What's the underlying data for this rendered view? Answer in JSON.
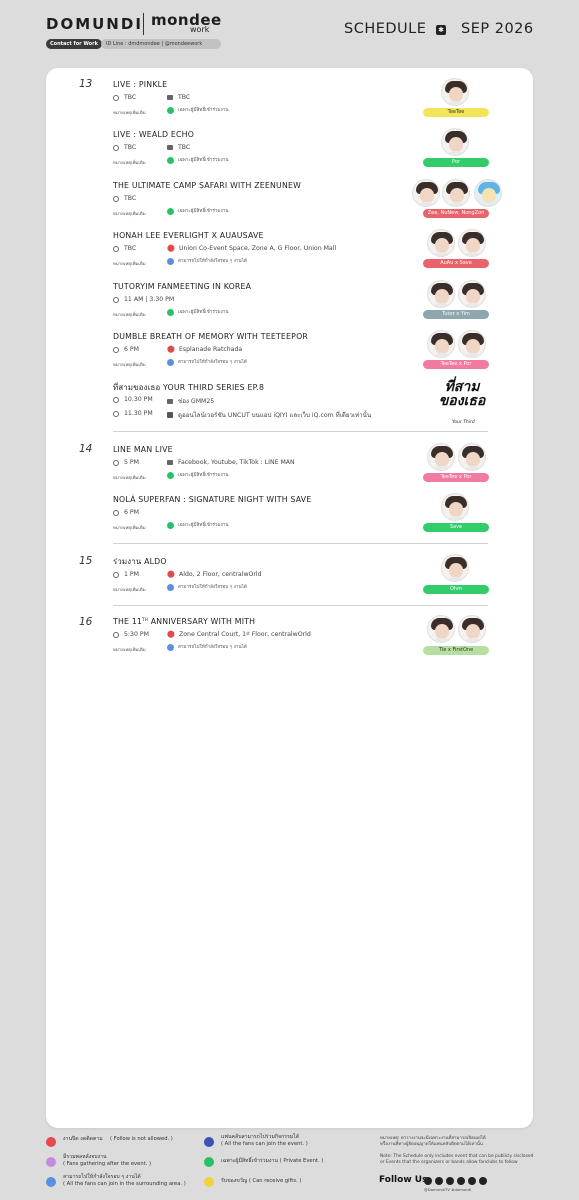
{
  "header": {
    "brand": "DOMUNDI",
    "partner": "mondee",
    "partner_sub": "work",
    "contact_label": "Contact for Work",
    "id_line": "ID Line : dmdmondee | @mondeework",
    "title": "SCHEDULE",
    "date": "SEP 2026"
  },
  "days": [
    {
      "day": "13",
      "events": [
        {
          "title": "LIVE : PINKLE",
          "time": "TBC",
          "place": "TBC",
          "note_label": "หมายเหตุเพิ่มเติม",
          "note": "เฉพาะผู้มีสิทธิ์เข้าร่วมงาน",
          "badge": "TeeTee"
        },
        {
          "title": "LIVE : WEALD ECHO",
          "time": "TBC",
          "place": "TBC",
          "note_label": "หมายเหตุเพิ่มเติม",
          "note": "เฉพาะผู้มีสิทธิ์เข้าร่วมงาน",
          "badge": "Por"
        },
        {
          "title": "THE ULTIMATE CAMP SAFARI WITH ZEENUNEW",
          "time": "TBC",
          "note_label": "หมายเหตุเพิ่มเติม",
          "note": "เฉพาะผู้มีสิทธิ์เข้าร่วมงาน",
          "badge": "Zee, NuNew, NongZon"
        },
        {
          "title": "HONAH LEE EVERLIGHT X AUAUSAVE",
          "time": "TBC",
          "place": "Union Co-Event Space, Zone A, G Floor, Union Mall",
          "note_label": "หมายเหตุเพิ่มเติม",
          "note": "สามารถไปให้กำลังใจรอบ ๆ งานได้",
          "badge": "AuAu  x  Save"
        },
        {
          "title": "TUTORYIM FANMEETING IN KOREA",
          "time": "11 AM  |  3.30 PM",
          "note_label": "หมายเหตุเพิ่มเติม",
          "note": "เฉพาะผู้มีสิทธิ์เข้าร่วมงาน",
          "badge": "Tutor  x  Yim"
        },
        {
          "title": "DUMBLE BREATH OF MEMORY WITH TEETEEPOR",
          "time": "6 PM",
          "place": "Esplanade Ratchada",
          "note_label": "หมายเหตุเพิ่มเติม",
          "note": "สามารถไปให้กำลังใจรอบ ๆ งานได้",
          "badge": "TeeTee  x  Por"
        },
        {
          "title": "ที่สามของเธอ YOUR THIRD SERIES EP.8",
          "time": "10.30 PM",
          "place": "ช่อง GMM25",
          "time2": "11.30 PM",
          "place2": "ดูออนไลน์เวอร์ชัน UNCUT บนแอป iQIYI และเว็บ iQ.com ที่เดียวเท่านั้น",
          "logo": "ที่สาม ของเธอ",
          "logo_sub": "Your Third"
        }
      ]
    },
    {
      "day": "14",
      "events": [
        {
          "title": "LINE MAN LIVE",
          "time": "5 PM",
          "place": "Facebook, Youtube, TikTok : LINE MAN",
          "note_label": "หมายเหตุเพิ่มเติม",
          "note": "เฉพาะผู้มีสิทธิ์เข้าร่วมงาน",
          "badge": "TeeTee  x  Por"
        },
        {
          "title": "NOLÁ SUPERFAN : SIGNATURE NIGHT WITH SAVE",
          "time": "6 PM",
          "note_label": "หมายเหตุเพิ่มเติม",
          "note": "เฉพาะผู้มีสิทธิ์เข้าร่วมงาน",
          "badge": "Save"
        }
      ]
    },
    {
      "day": "15",
      "events": [
        {
          "title": "ร่วมงาน ALDO",
          "time": "1 PM",
          "place": "Aldo, 2 Floor, centralwOrld",
          "note_label": "หมายเหตุเพิ่มเติม",
          "note": "สามารถไปให้กำลังใจรอบ ๆ งานได้",
          "badge": "Ohm"
        }
      ]
    },
    {
      "day": "16",
      "events": [
        {
          "title_pre": "THE 11",
          "title_sup": "TH",
          "title_post": " ANNIVERSARY WITH MITH",
          "time": "5:30 PM",
          "place_pre": "Zone Central Court, 1",
          "place_sup": "st",
          "place_post": " Floor, centralwOrld",
          "note_label": "หมายเหตุเพิ่มเติม",
          "note": "สามารถไปให้กำลังใจรอบ ๆ งานได้",
          "badge": "Tle  x  FirstOne"
        }
      ]
    }
  ],
  "legend": {
    "items": [
      {
        "th": "งานปิด งดติดตาม",
        "en": "( Follow is not allowed. )",
        "icon": "no-entry-icon",
        "color": "#e5484d"
      },
      {
        "th": "มีรวมพลหลังจบงาน",
        "en": "( Fans gathering after the event. )",
        "icon": "gathering-icon",
        "color": "#c58be0"
      },
      {
        "th": "สามารถไปให้กำลังใจรอบ ๆ งานได้",
        "en": "( All the fans can join in the surrounding area. )",
        "icon": "thumbs-up-icon",
        "color": "#5b8fe0"
      },
      {
        "th": "แฟนคลับสามารถไปร่วมกิจกรรมได้",
        "en": "( All the fans can join the event. )",
        "icon": "group-icon",
        "color": "#3f51b5"
      },
      {
        "th": "เฉพาะผู้มีสิทธิ์เข้าร่วมงาน",
        "en": "( Private Event. )",
        "icon": "private-icon",
        "color": "#27c268"
      },
      {
        "th": "รับของขวัญ",
        "en": "( Can receive gifts. )",
        "icon": "gift-icon",
        "color": "#f1d23a"
      }
    ],
    "note_th_1": "หมายเหตุ: ตารางงานจะมีเฉพาะงานที่สามารถเปิดเผยได้",
    "note_th_2": "หรืองานที่ทางผู้จัดอนุญาตให้แฟนคลับติดตามได้เท่านั้น",
    "note_en_1": "Note: The Schedule only includes event that can be publicly sisclosed",
    "note_en_2": "or Events that the organizers or bands allow fanclubs to follow",
    "follow": "Follow Us",
    "handle": "@DomundiTV",
    "hashtag": "#domundi"
  }
}
